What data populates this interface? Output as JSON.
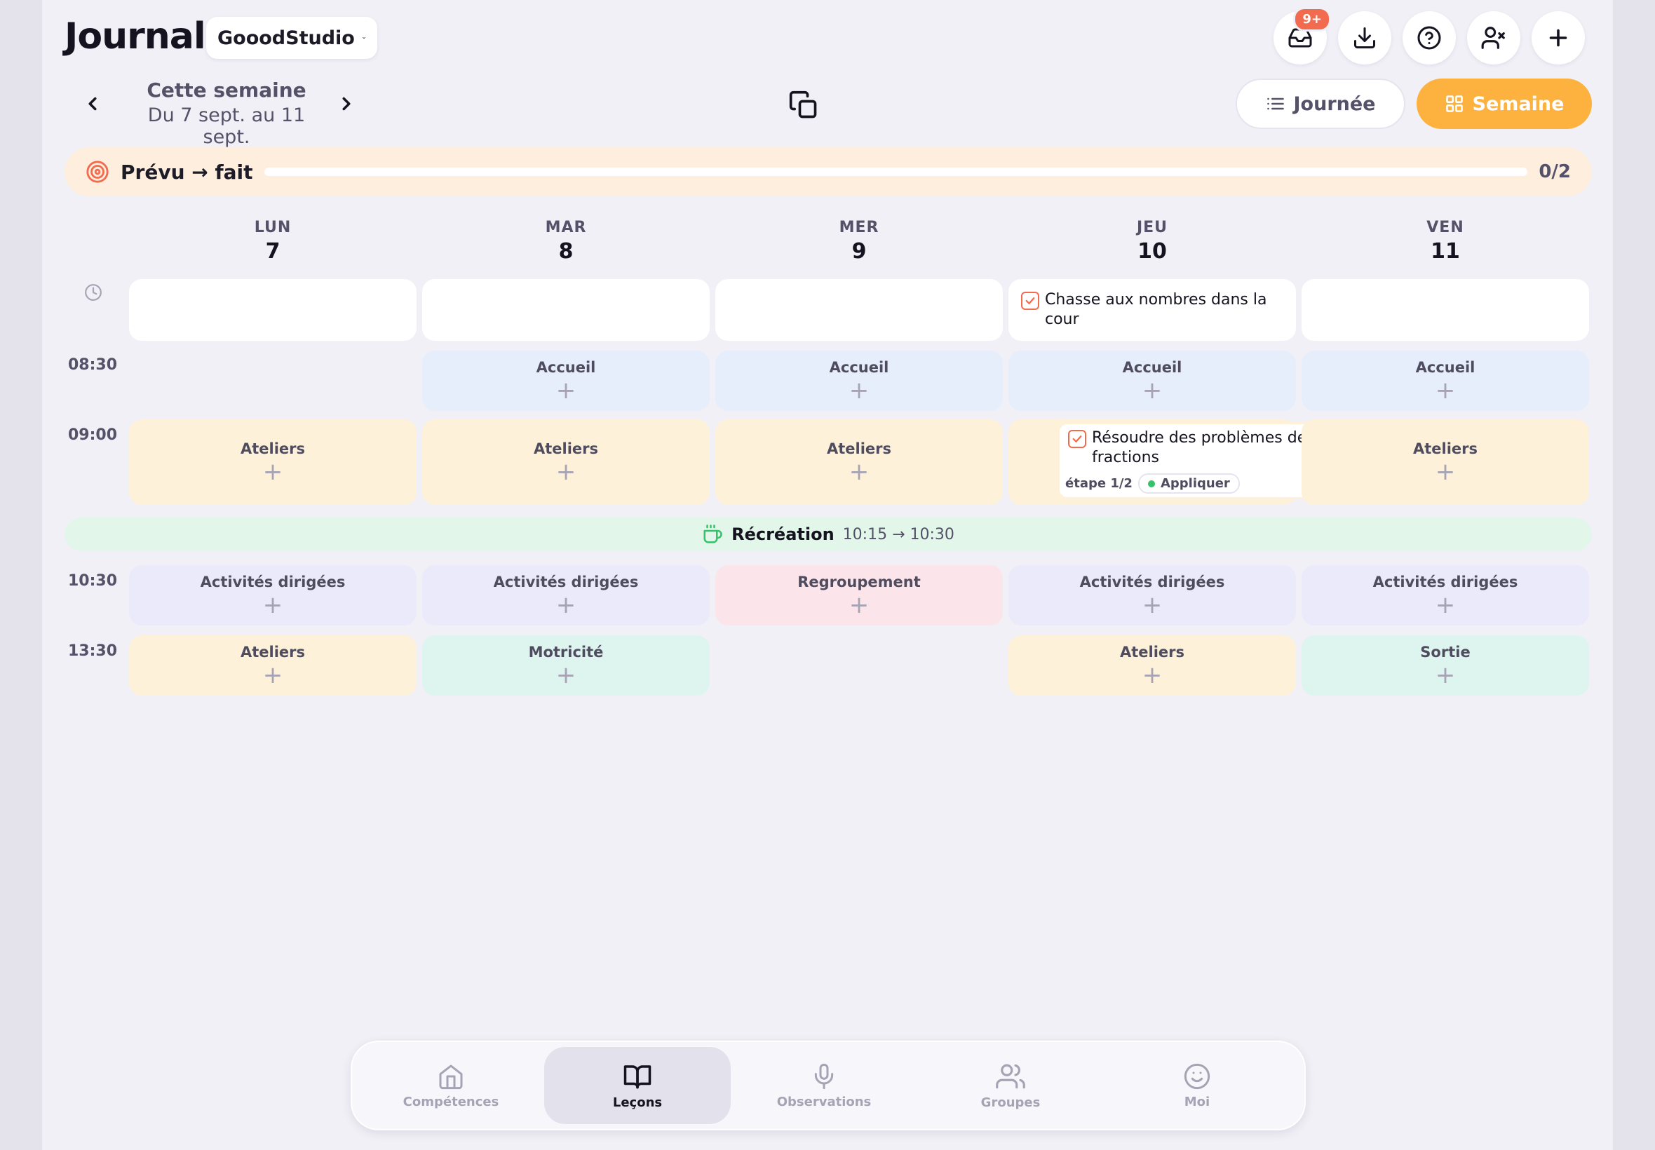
{
  "header": {
    "title": "Journal",
    "school": "GooodStudio",
    "inbox_badge": "9+"
  },
  "week": {
    "label": "Cette semaine",
    "range": "Du 7 sept. au 11 sept."
  },
  "views": {
    "day_label": "Journée",
    "week_label": "Semaine",
    "selected": "Semaine"
  },
  "progress": {
    "label": "Prévu → fait",
    "count": "0/2",
    "fraction": 0
  },
  "days": [
    {
      "name": "LUN",
      "date": "7"
    },
    {
      "name": "MAR",
      "date": "8"
    },
    {
      "name": "MER",
      "date": "9"
    },
    {
      "name": "JEU",
      "date": "10"
    },
    {
      "name": "VEN",
      "date": "11"
    }
  ],
  "times": [
    "08:30",
    "09:00",
    "10:30",
    "13:30"
  ],
  "tasks": {
    "jeu_morning": "Chasse aux nombres dans la cour",
    "jeu_0900": "Résoudre des problèmes de fractions",
    "jeu_0900_step": "étape 1/2",
    "jeu_0900_phase": "Appliquer"
  },
  "slots": {
    "row_0830": [
      "",
      "Accueil",
      "Accueil",
      "Accueil",
      "Accueil"
    ],
    "row_0900": [
      "Ateliers",
      "Ateliers",
      "Ateliers",
      "",
      "Ateliers"
    ],
    "row_1030": [
      "Activités dirigées",
      "Activités dirigées",
      "Regroupement",
      "Activités dirigées",
      "Activités dirigées"
    ],
    "row_1330": [
      "Ateliers",
      "Motricité",
      "",
      "Ateliers",
      "Sortie"
    ]
  },
  "recess": {
    "label": "Récréation",
    "time": "10:15 → 10:30"
  },
  "nav": [
    {
      "label": "Compétences",
      "icon": "home-icon"
    },
    {
      "label": "Leçons",
      "icon": "book-icon",
      "active": true
    },
    {
      "label": "Observations",
      "icon": "microphone-icon"
    },
    {
      "label": "Groupes",
      "icon": "users-icon"
    },
    {
      "label": "Moi",
      "icon": "smiley-icon"
    }
  ],
  "colors": {
    "accent": "#fdb13f",
    "badge": "#f26b4f",
    "accueil": "#e6eefc",
    "ateliers": "#fdf1d9",
    "activites": "#ebeafb",
    "regroupement": "#fce5ea",
    "motricite": "#def5ef",
    "recess": "#e2f6ea"
  }
}
